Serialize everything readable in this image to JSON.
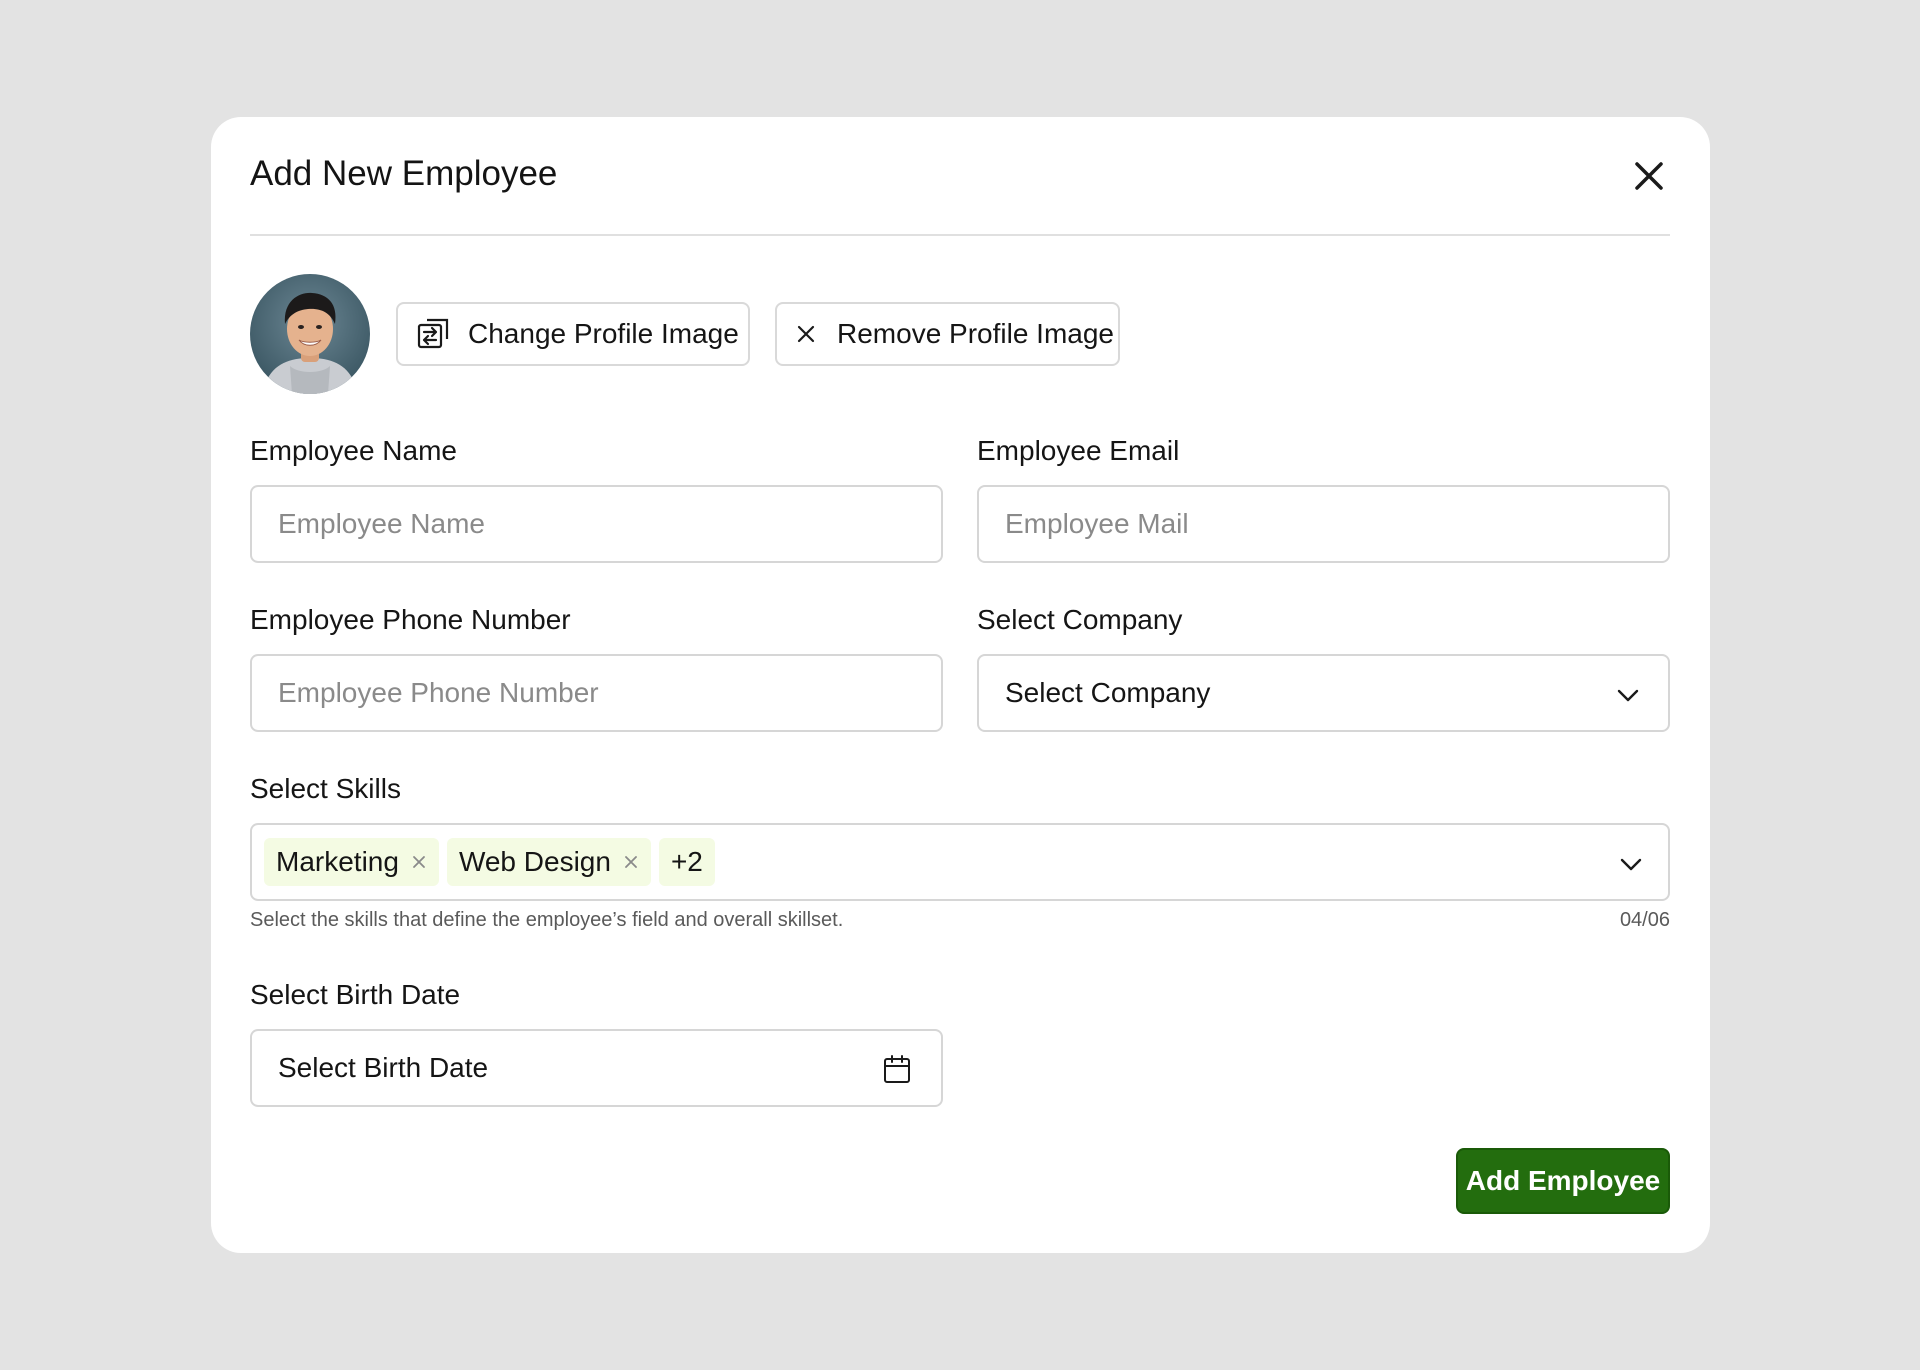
{
  "modal": {
    "title": "Add New Employee"
  },
  "profile": {
    "change_label": "Change Profile Image",
    "remove_label": "Remove Profile Image"
  },
  "fields": {
    "name": {
      "label": "Employee Name",
      "placeholder": "Employee Name",
      "value": ""
    },
    "email": {
      "label": "Employee Email",
      "placeholder": "Employee Mail",
      "value": ""
    },
    "phone": {
      "label": "Employee Phone Number",
      "placeholder": "Employee Phone Number",
      "value": ""
    },
    "company": {
      "label": "Select Company",
      "value": "Select Company"
    },
    "skills": {
      "label": "Select Skills",
      "chips": [
        "Marketing",
        "Web Design"
      ],
      "more": "+2",
      "helper": "Select the skills that define the employee’s field and overall skillset.",
      "counter": "04/06"
    },
    "birth_date": {
      "label": "Select Birth Date",
      "value": "Select Birth Date"
    }
  },
  "actions": {
    "submit_label": "Add Employee"
  },
  "colors": {
    "primary": "#236d0e",
    "chip_bg": "#f4fbe3",
    "backdrop": "#e3e3e3"
  }
}
